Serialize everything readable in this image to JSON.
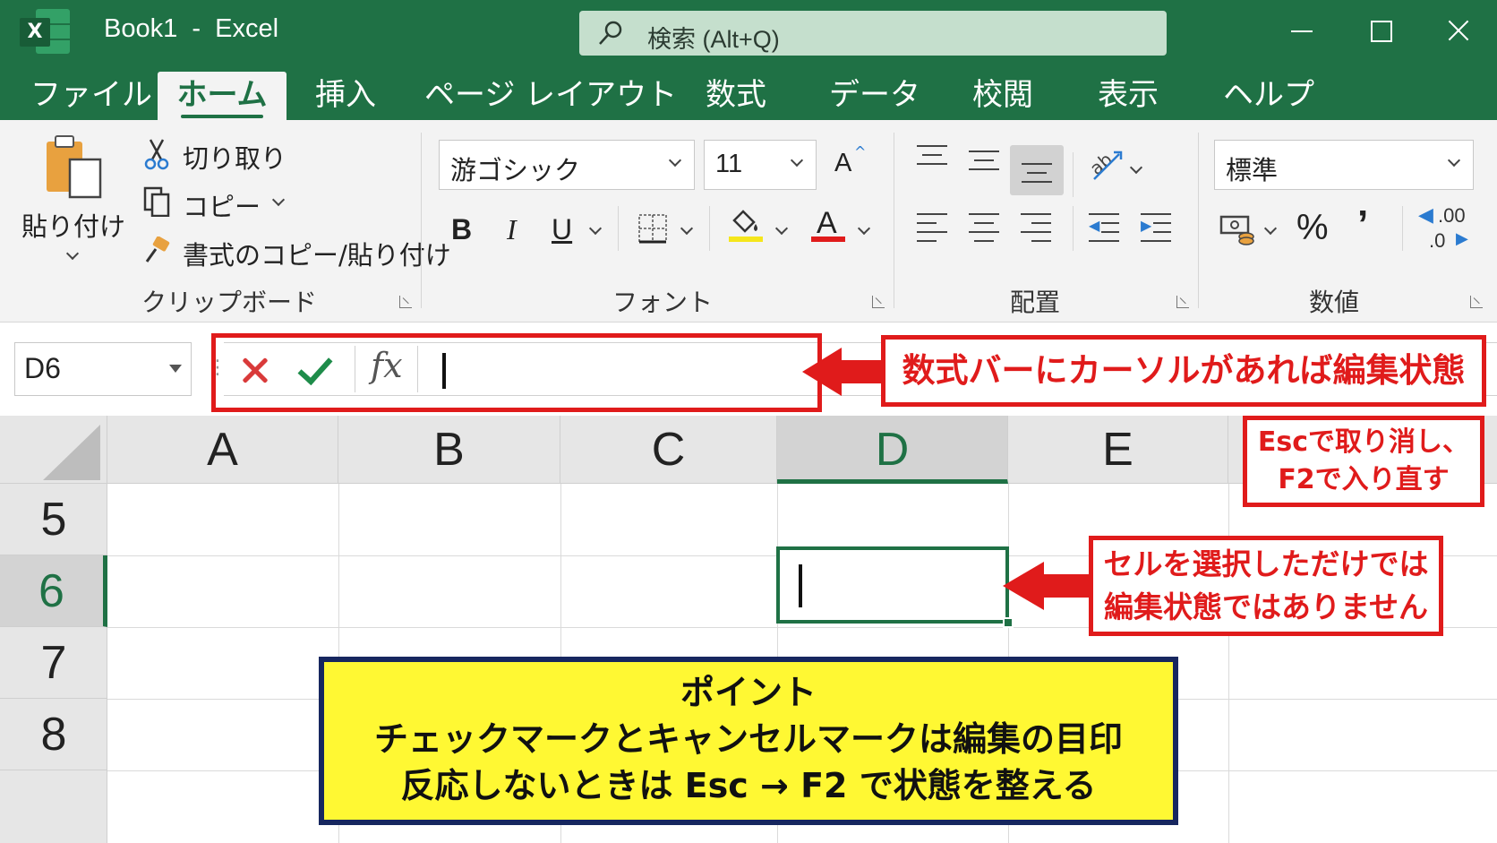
{
  "window": {
    "title": "Book1  -  Excel",
    "search_placeholder": "検索 (Alt+Q)"
  },
  "tabs": [
    "ファイル",
    "ホーム",
    "挿入",
    "ページ レイアウト",
    "数式",
    "データ",
    "校閲",
    "表示",
    "ヘルプ"
  ],
  "active_tab": "ホーム",
  "ribbon": {
    "clipboard": {
      "paste": "貼り付け",
      "cut": "切り取り",
      "copy": "コピー",
      "format_painter": "書式のコピー/貼り付け",
      "group_label": "クリップボード"
    },
    "font": {
      "font_name": "游ゴシック",
      "font_size": "11",
      "bold": "B",
      "italic": "I",
      "underline": "U",
      "font_color_letter": "A",
      "grow_letter": "A",
      "group_label": "フォント",
      "fill_color": "#f5e61b",
      "text_color": "#e01b1b"
    },
    "alignment": {
      "group_label": "配置"
    },
    "number": {
      "format": "標準",
      "percent": "%",
      "comma": "’",
      "decimal_top": ".00",
      "decimal_bottom": ".0",
      "group_label": "数値"
    }
  },
  "formula_bar": {
    "name_box": "D6",
    "fx": "fx",
    "value": ""
  },
  "grid": {
    "columns": [
      "A",
      "B",
      "C",
      "D",
      "E"
    ],
    "rows": [
      "5",
      "6",
      "7",
      "8"
    ],
    "selected_column": "D",
    "selected_row": "6",
    "accent": "#1f7145"
  },
  "annotations": {
    "formula_callout": "数式バーにカーソルがあれば編集状態",
    "esc_callout": [
      "Escで取り消し、",
      "F2で入り直す"
    ],
    "cell_callout": [
      "セルを選択しただけでは",
      "編集状態ではありません"
    ],
    "point_box": [
      "ポイント",
      "チェックマークとキャンセルマークは編集の目印",
      "反応しないときは Esc → F2 で状態を整える"
    ],
    "callout_color": "#e01b1b",
    "point_bg": "#fff833"
  }
}
